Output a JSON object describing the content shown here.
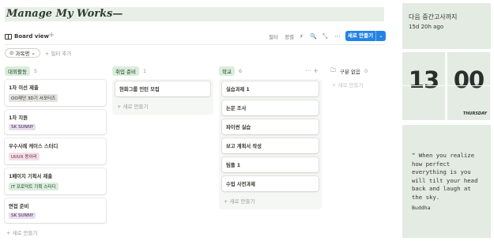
{
  "page": {
    "title": "Manage My Works—"
  },
  "toolbar": {
    "view_tab": "Board view",
    "add_view": "+",
    "filter": "필터",
    "sort": "정렬",
    "lightning": "⚡",
    "search": "🔍",
    "expand": "⤡",
    "more": "···",
    "new_label": "새로 만들기",
    "new_dropdown": "⌄"
  },
  "filters": {
    "chip_icon": "⊙",
    "chip_label": "과목명",
    "chip_caret": "⌄",
    "add_filter": "+ 필터 추가"
  },
  "board": {
    "add_label": "+ 새로 만들기",
    "groups": [
      {
        "name": "대외활동",
        "count": "5",
        "color": "#dbeddb",
        "text_color": "#1c3829",
        "cards": [
          {
            "name": "1차 이선 제출",
            "tag": "OO재단 3D기 서포터즈",
            "tag_bg": "#e3e2e0",
            "tag_fg": "#32302c"
          },
          {
            "name": "1차 지원",
            "tag": "SK SUNNY",
            "tag_bg": "#e8deee",
            "tag_fg": "#412454"
          },
          {
            "name": "우수사례 케이스 스터디",
            "tag": "UI/UX 동아리",
            "tag_bg": "#f4dfeb",
            "tag_fg": "#5d1715"
          },
          {
            "name": "1페이지 기획서 제출",
            "tag": "IT 프로덕트 기획 스터디",
            "tag_bg": "#dbeddb",
            "tag_fg": "#1c3829"
          },
          {
            "name": "면접 준비",
            "tag": "SK SUNNY",
            "tag_bg": "#e8deee",
            "tag_fg": "#412454"
          }
        ]
      },
      {
        "name": "취업 준비",
        "count": "1",
        "color": "#dbeddb",
        "text_color": "#1c3829",
        "cards": [
          {
            "name": "현화그룹 인턴 모집"
          }
        ]
      },
      {
        "name": "학교",
        "count": "6",
        "color": "#dbeddb",
        "text_color": "#1c3829",
        "tools": "··· +",
        "cards": [
          {
            "name": "실습과제 1"
          },
          {
            "name": "논문 조사"
          },
          {
            "name": "파이썬 실습"
          },
          {
            "name": "보고 계획서 작성"
          },
          {
            "name": "팀플 1"
          },
          {
            "name": "수업 사전과제"
          }
        ]
      },
      {
        "name": "구분 없음",
        "count": "0",
        "icon": "🗀",
        "cards": []
      }
    ]
  },
  "widgets": {
    "countdown": {
      "title": "다음 중간고사까지",
      "value": "15d 20h ago"
    },
    "clock": {
      "hour": "13",
      "minute": "00",
      "day": "THURSDAY"
    },
    "quote": {
      "icon": "❝",
      "text": " When you realize how perfect everything is you will tilt your head back and laugh at the sky.",
      "author": "Buddha"
    }
  },
  "colors": {
    "accent": "#2383e2",
    "widget_bg": "#e3ebe3",
    "title_bg": "#e8efe7",
    "group_bg": "#f5f7f4"
  }
}
